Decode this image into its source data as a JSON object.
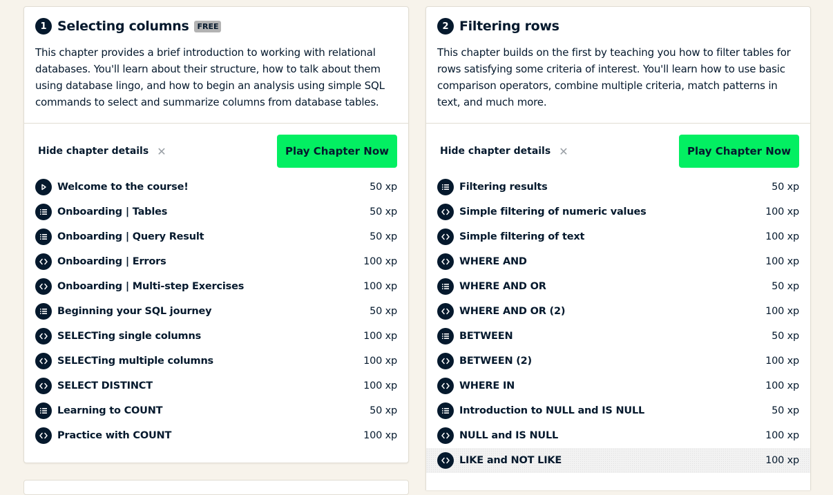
{
  "chapters": [
    {
      "number": "1",
      "title": "Selecting columns",
      "badge": "FREE",
      "description": "This chapter provides a brief introduction to working with relational databases. You'll learn about their structure, how to talk about them using database lingo, and how to begin an analysis using simple SQL commands to select and summarize columns from database tables.",
      "hide_label": "Hide chapter details",
      "play_label": "Play Chapter Now",
      "exercises": [
        {
          "icon": "play-icon",
          "title": "Welcome to the course!",
          "xp": "50 xp"
        },
        {
          "icon": "list-icon",
          "title": "Onboarding | Tables",
          "xp": "50 xp"
        },
        {
          "icon": "list-icon",
          "title": "Onboarding | Query Result",
          "xp": "50 xp"
        },
        {
          "icon": "code-icon",
          "title": "Onboarding | Errors",
          "xp": "100 xp"
        },
        {
          "icon": "code-icon",
          "title": "Onboarding | Multi-step Exercises",
          "xp": "100 xp"
        },
        {
          "icon": "list-icon",
          "title": "Beginning your SQL journey",
          "xp": "50 xp"
        },
        {
          "icon": "code-icon",
          "title": "SELECTing single columns",
          "xp": "100 xp"
        },
        {
          "icon": "code-icon",
          "title": "SELECTing multiple columns",
          "xp": "100 xp"
        },
        {
          "icon": "code-icon",
          "title": "SELECT DISTINCT",
          "xp": "100 xp"
        },
        {
          "icon": "list-icon",
          "title": "Learning to COUNT",
          "xp": "50 xp"
        },
        {
          "icon": "code-icon",
          "title": "Practice with COUNT",
          "xp": "100 xp"
        }
      ]
    },
    {
      "number": "2",
      "title": "Filtering rows",
      "badge": "",
      "description": "This chapter builds on the first by teaching you how to filter tables for rows satisfying some criteria of interest. You'll learn how to use basic comparison operators, combine multiple criteria, match patterns in text, and much more.",
      "hide_label": "Hide chapter details",
      "play_label": "Play Chapter Now",
      "exercises": [
        {
          "icon": "list-icon",
          "title": "Filtering results",
          "xp": "50 xp"
        },
        {
          "icon": "code-icon",
          "title": "Simple filtering of numeric values",
          "xp": "100 xp"
        },
        {
          "icon": "code-icon",
          "title": "Simple filtering of text",
          "xp": "100 xp"
        },
        {
          "icon": "code-icon",
          "title": "WHERE AND",
          "xp": "100 xp"
        },
        {
          "icon": "list-icon",
          "title": "WHERE AND OR",
          "xp": "50 xp"
        },
        {
          "icon": "code-icon",
          "title": "WHERE AND OR (2)",
          "xp": "100 xp"
        },
        {
          "icon": "list-icon",
          "title": "BETWEEN",
          "xp": "50 xp"
        },
        {
          "icon": "code-icon",
          "title": "BETWEEN (2)",
          "xp": "100 xp"
        },
        {
          "icon": "code-icon",
          "title": "WHERE IN",
          "xp": "100 xp"
        },
        {
          "icon": "list-icon",
          "title": "Introduction to NULL and IS NULL",
          "xp": "50 xp"
        },
        {
          "icon": "code-icon",
          "title": "NULL and IS NULL",
          "xp": "100 xp"
        },
        {
          "icon": "code-icon",
          "title": "LIKE and NOT LIKE",
          "xp": "100 xp",
          "highlighted": true
        }
      ]
    }
  ],
  "colors": {
    "accent": "#03ef62",
    "navy": "#05192d",
    "background": "#f7f3eb"
  }
}
